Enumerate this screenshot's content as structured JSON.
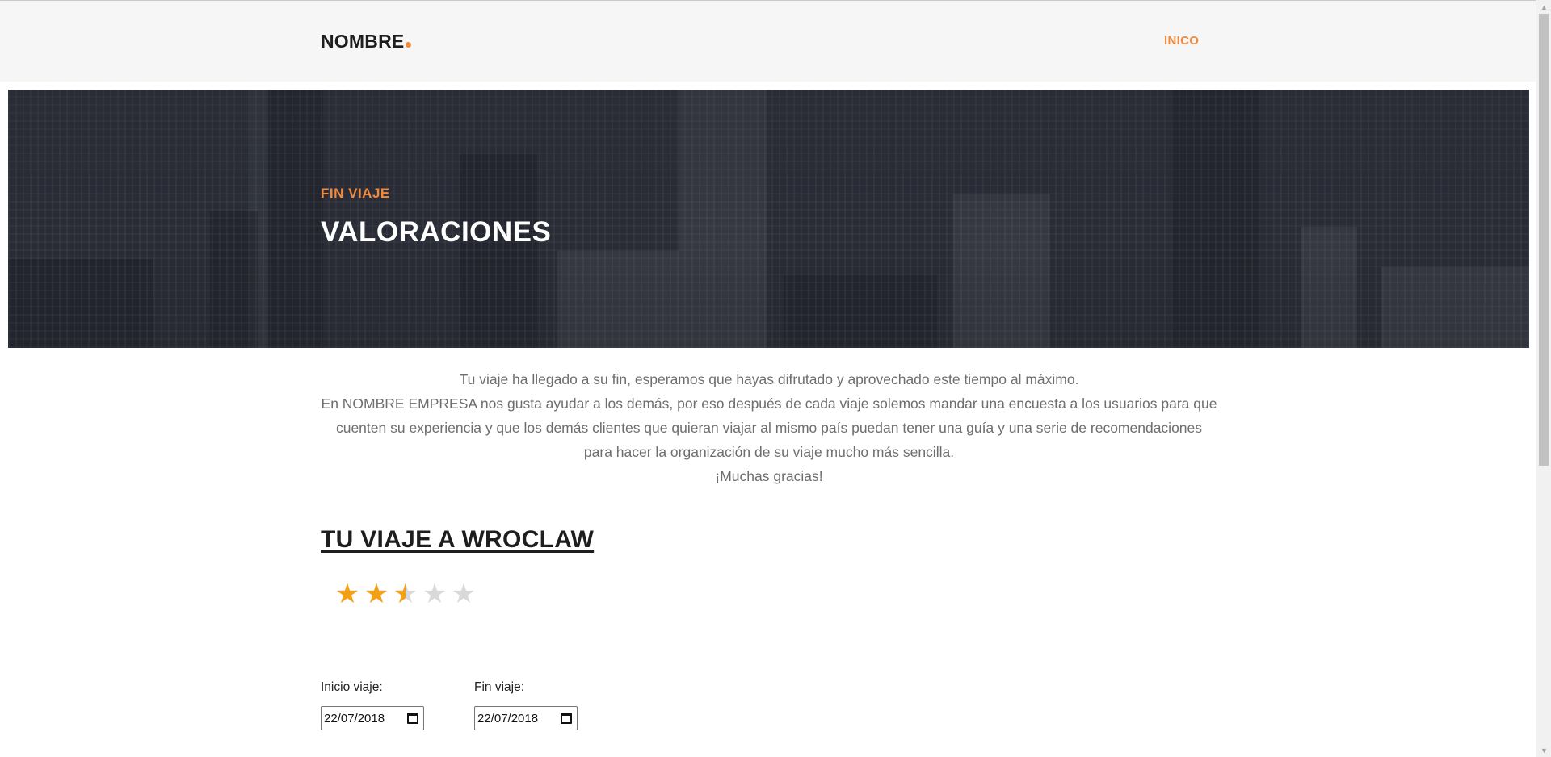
{
  "header": {
    "brand": "NOMBRE",
    "nav": {
      "inicio": "INICO"
    }
  },
  "hero": {
    "kicker": "FIN VIAJE",
    "title": "VALORACIONES"
  },
  "intro": {
    "line1": "Tu viaje ha llegado a su fin, esperamos que hayas difrutado y aprovechado este tiempo al máximo.",
    "paragraph": "En NOMBRE EMPRESA nos gusta ayudar a los demás, por eso después de cada viaje solemos mandar una encuesta a los usuarios para que cuenten su experiencia y que los demás clientes que quieran viajar al mismo país puedan tener una guía y una serie de recomendaciones para hacer la organización de su viaje mucho más sencilla.",
    "thanks": "¡Muchas gracias!"
  },
  "trip": {
    "title": "TU VIAJE A WROCLAW",
    "rating": {
      "value": 2.5,
      "max": 5
    },
    "start": {
      "label": "Inicio viaje:",
      "value": "22/07/2018"
    },
    "end": {
      "label": "Fin viaje:",
      "value": "22/07/2018"
    }
  },
  "colors": {
    "accent": "#f28a3c",
    "star_filled": "#f5a012",
    "star_empty": "#d9d9d9",
    "hero_bg": "#2b2d37"
  },
  "icons": {
    "star": "star-icon",
    "calendar": "calendar-icon",
    "scroll_up": "arrow-up-icon",
    "scroll_down": "arrow-down-icon"
  }
}
